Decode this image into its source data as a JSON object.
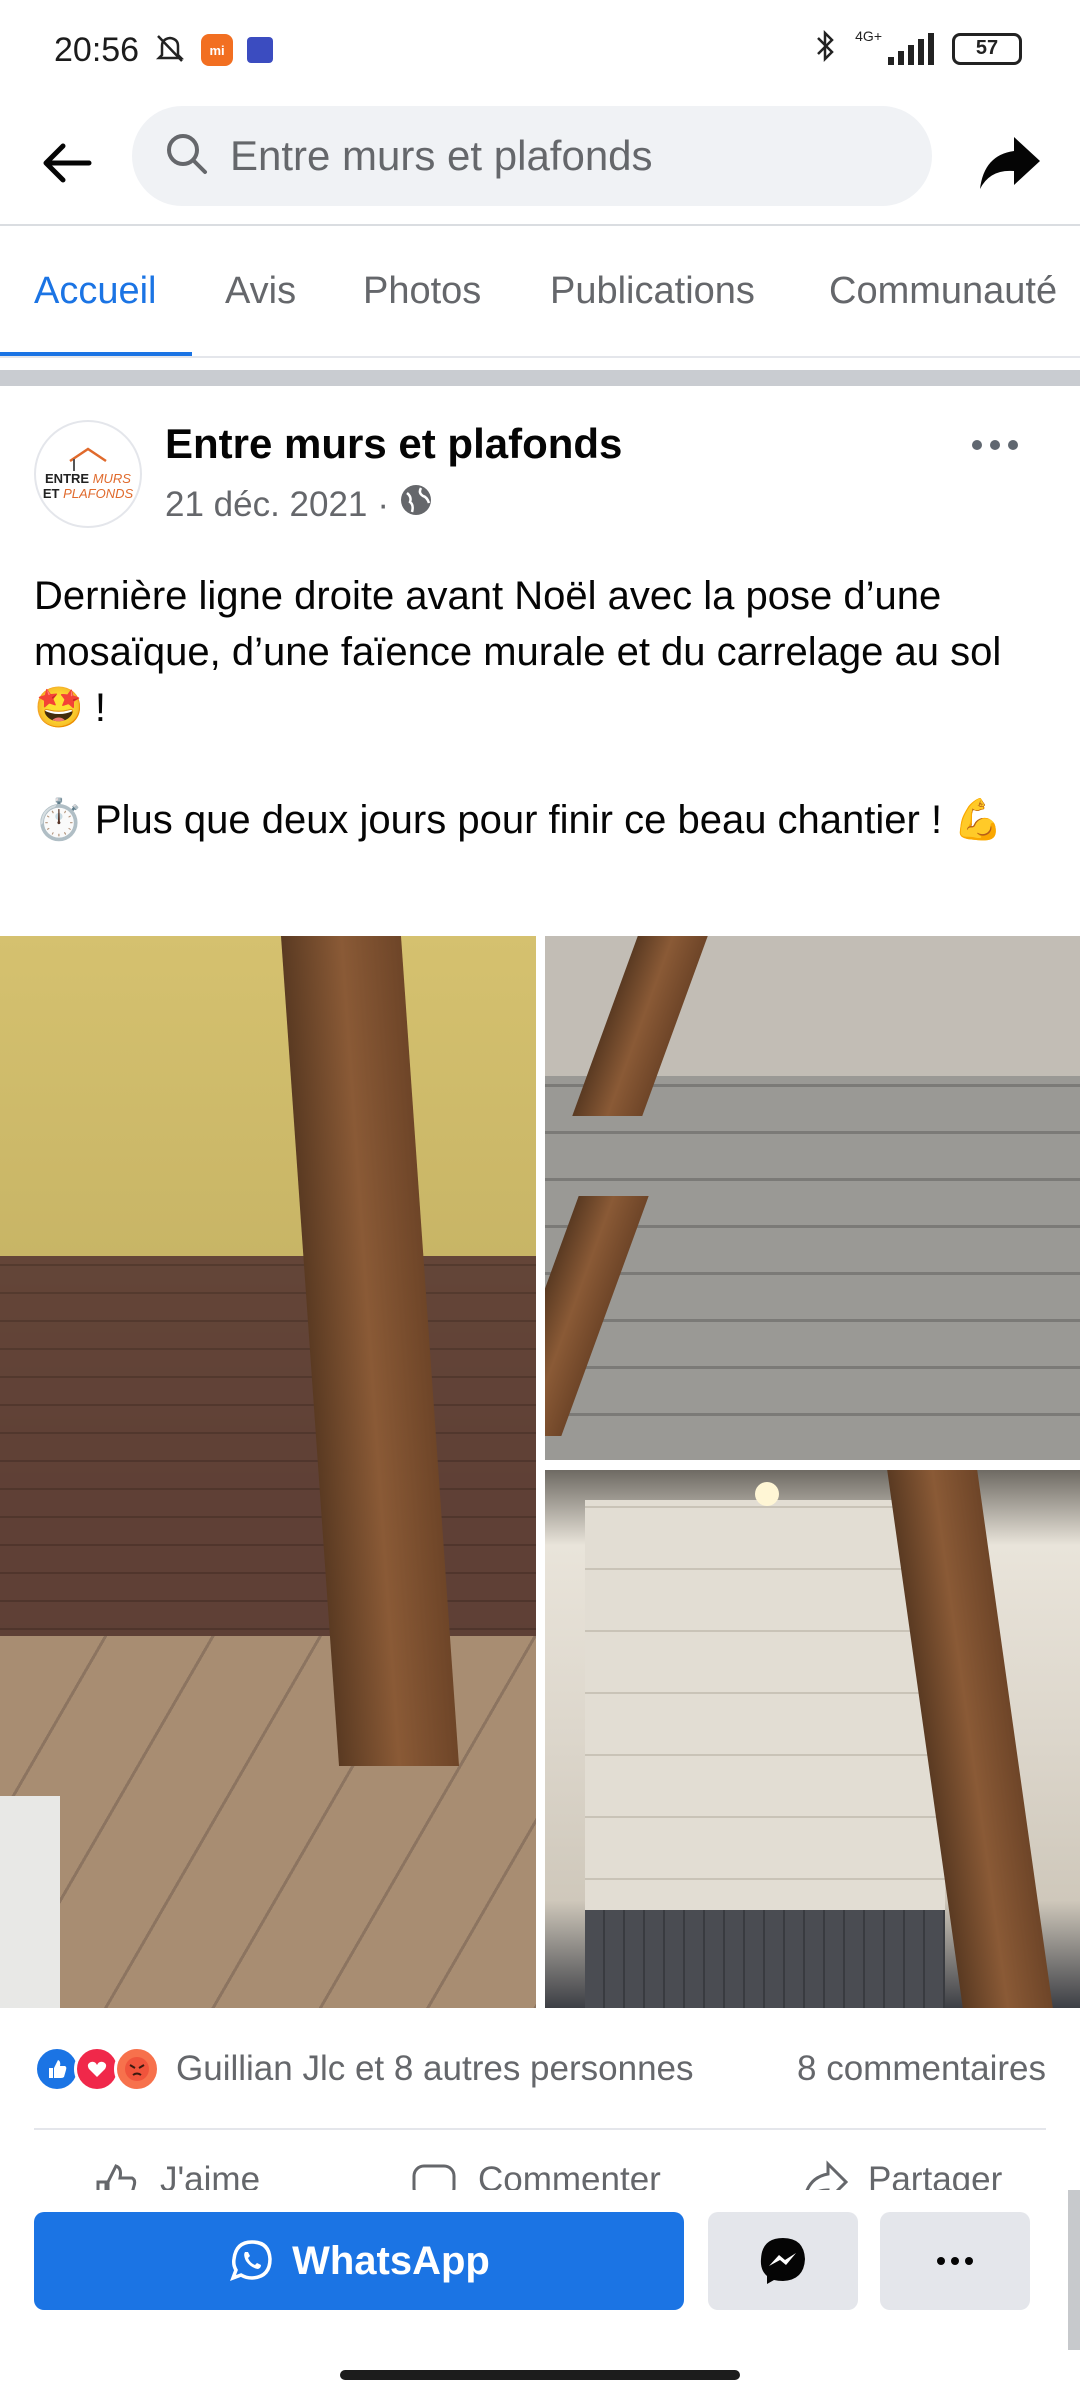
{
  "status_bar": {
    "time": "20:56",
    "network": "4G+",
    "battery": "57",
    "mi_label": "mi"
  },
  "search": {
    "text": "Entre murs et plafonds"
  },
  "tabs": [
    {
      "label": "Accueil",
      "active": true
    },
    {
      "label": "Avis",
      "active": false
    },
    {
      "label": "Photos",
      "active": false
    },
    {
      "label": "Publications",
      "active": false
    },
    {
      "label": "Communauté",
      "active": false
    }
  ],
  "post": {
    "page_name": "Entre murs et plafonds",
    "date": "21 déc. 2021",
    "separator": "·",
    "avatar_line1a": "ENTRE",
    "avatar_line1b": "MURS",
    "avatar_line2a": "ET",
    "avatar_line2b": "PLAFONDS",
    "text_line1": "Dernière ligne droite avant Noël avec la pose d’une mosaïque, d’une faïence murale et du carrelage au sol 🤩 !",
    "text_line2": "⏱️ Plus que deux jours pour finir ce beau chantier ! 💪"
  },
  "engagement": {
    "reactions_text": "Guillian Jlc et 8 autres personnes",
    "comments": "8 commentaires",
    "like_label": "J'aime",
    "comment_label": "Commenter",
    "share_label": "Partager"
  },
  "bottom": {
    "whatsapp_label": "WhatsApp"
  },
  "colors": {
    "accent": "#1b74e4",
    "muted": "#65676b",
    "button_bg": "#e4e6eb"
  }
}
